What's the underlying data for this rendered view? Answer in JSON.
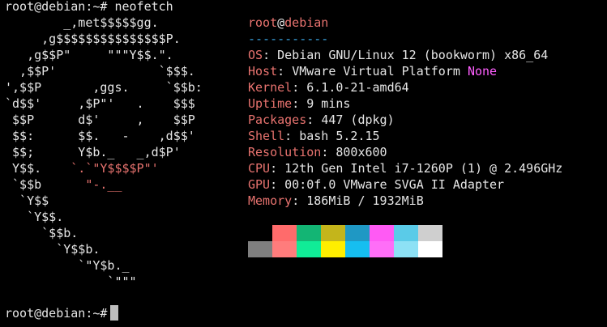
{
  "command_line": {
    "prompt": "root@debian:~#",
    "command": "neofetch"
  },
  "logo": {
    "color": "#e8736f",
    "lines": [
      {
        "plain": "        _,met$$$$$gg.",
        "red": ""
      },
      {
        "plain": "     ,g$$$$$$$$$$$$$$$P.",
        "red": ""
      },
      {
        "plain": "   ,g$$P\"     \"\"\"Y$$.\".",
        "red": ""
      },
      {
        "plain": "  ,$$P'              `$$$.",
        "red": ""
      },
      {
        "plain": "',$$P       ,ggs.     `$$b:",
        "red": ""
      },
      {
        "plain": "`d$$'     ,$P\"'   .    $$$",
        "red": ""
      },
      {
        "plain": " $$P      d$'     ,    $$P",
        "red": ""
      },
      {
        "plain": " $$:      $$.   -    ,d$$'",
        "red": ""
      },
      {
        "plain": " $$;      Y$b._   _,d$P'",
        "red": ""
      },
      {
        "plain": " Y$$.    ",
        "red": "`.`\"Y$$$$P\"'"
      },
      {
        "plain": " `$$b      ",
        "red": "\"-.__"
      },
      {
        "plain": "  `Y$$",
        "red": ""
      },
      {
        "plain": "   `Y$$.",
        "red": ""
      },
      {
        "plain": "     `$$b.",
        "red": ""
      },
      {
        "plain": "       `Y$$b.",
        "red": ""
      },
      {
        "plain": "          `\"Y$b._",
        "red": ""
      },
      {
        "plain": "              `\"\"\"",
        "red": ""
      }
    ]
  },
  "info": {
    "user": "root",
    "at": "@",
    "host": "debian",
    "separator": "-----------",
    "rows": [
      {
        "key": "OS",
        "value": "Debian GNU/Linux 12 (bookworm) x86_64",
        "extra": ""
      },
      {
        "key": "Host",
        "value": "VMware Virtual Platform ",
        "extra": "None"
      },
      {
        "key": "Kernel",
        "value": "6.1.0-21-amd64",
        "extra": ""
      },
      {
        "key": "Uptime",
        "value": "9 mins",
        "extra": ""
      },
      {
        "key": "Packages",
        "value": "447 (dpkg)",
        "extra": ""
      },
      {
        "key": "Shell",
        "value": "bash 5.2.15",
        "extra": ""
      },
      {
        "key": "Resolution",
        "value": "800x600",
        "extra": ""
      },
      {
        "key": "CPU",
        "value": "12th Gen Intel i7-1260P (1) @ 2.496GHz",
        "extra": ""
      },
      {
        "key": "GPU",
        "value": "00:0f.0 VMware SVGA II Adapter",
        "extra": ""
      },
      {
        "key": "Memory",
        "value": "186MiB / 1932MiB",
        "extra": ""
      }
    ]
  },
  "palette": {
    "row1": [
      "#000000",
      "#ff6b6b",
      "#13b574",
      "#c4b51b",
      "#1f98c4",
      "#ff5af4",
      "#5acbe8",
      "#cfcfcf"
    ],
    "row2": [
      "#7f7f7f",
      "#ff7c7c",
      "#10ec97",
      "#ffee00",
      "#16bef0",
      "#ff6ef7",
      "#8de1f5",
      "#ffffff"
    ]
  },
  "bottom_prompt": "root@debian:~#",
  "colors": {
    "background": "#000000",
    "foreground": "#e6e6e6",
    "accent_red": "#e8736f",
    "accent_blue": "#3aa3e0",
    "magenta": "#ff5fff",
    "cursor": "#bdbdbd"
  }
}
